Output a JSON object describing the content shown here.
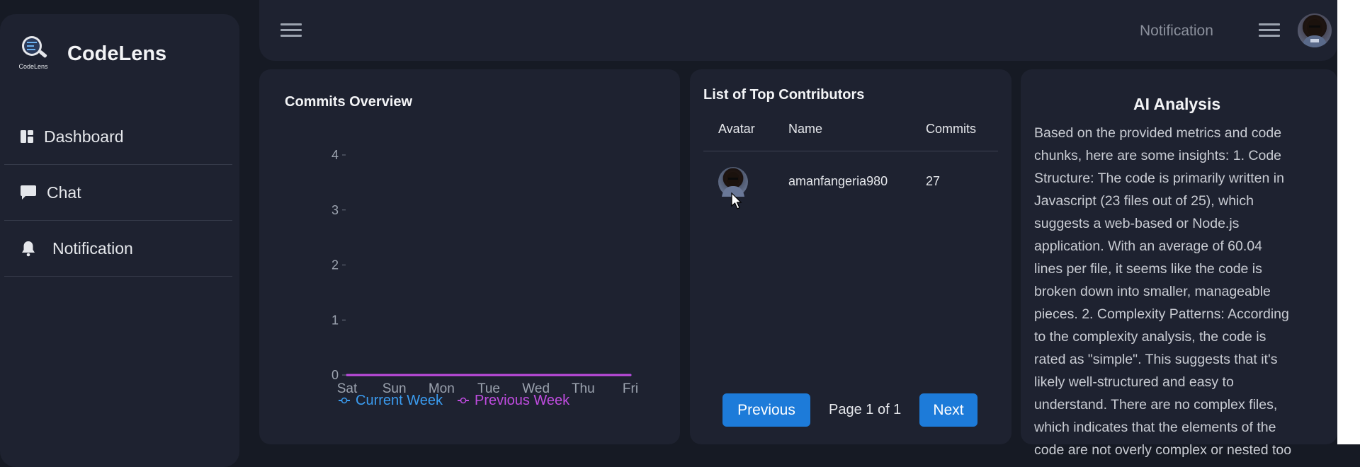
{
  "brand": {
    "name": "CodeLens",
    "logo_text": "CodeLens"
  },
  "sidebar": {
    "items": [
      {
        "label": "Dashboard",
        "icon": "dashboard-icon"
      },
      {
        "label": "Chat",
        "icon": "chat-icon"
      },
      {
        "label": "Notification",
        "icon": "bell-icon"
      }
    ]
  },
  "topbar": {
    "notification_label": "Notification"
  },
  "commits": {
    "title": "Commits Overview",
    "chart_data": {
      "type": "line",
      "categories": [
        "Sat",
        "Sun",
        "Mon",
        "Tue",
        "Wed",
        "Thu",
        "Fri"
      ],
      "series": [
        {
          "name": "Current Week",
          "values": [
            0,
            0,
            0,
            0,
            0,
            0,
            0
          ],
          "color": "#3b9cf0"
        },
        {
          "name": "Previous Week",
          "values": [
            0,
            0,
            0,
            0,
            0,
            0,
            0
          ],
          "color": "#c04ce0"
        }
      ],
      "ylim": [
        0,
        4
      ],
      "yticks": [
        "4",
        "3",
        "2",
        "1",
        "0"
      ],
      "grid": false,
      "legend": "bottom"
    }
  },
  "contributors": {
    "title": "List of Top Contributors",
    "columns": [
      "Avatar",
      "Name",
      "Commits"
    ],
    "rows": [
      {
        "name": "amanfangeria980",
        "commits": "27"
      }
    ],
    "pagination": {
      "previous": "Previous",
      "page_info": "Page 1 of 1",
      "next": "Next"
    }
  },
  "ai_analysis": {
    "title": "AI Analysis",
    "lines": [
      "Based on the provided metrics and code",
      "chunks, here are some insights: 1. Code",
      "Structure: The code is primarily written in",
      "Javascript (23 files out of 25), which",
      "suggests a web-based or Node.js",
      "application. With an average of 60.04",
      "lines per file, it seems like the code is",
      "broken down into smaller, manageable",
      "pieces. 2. Complexity Patterns: According",
      "to the complexity analysis, the code is",
      "rated as \"simple\". This suggests that it's",
      "likely well-structured and easy to",
      "understand. There are no complex files,",
      "which indicates that the elements of the",
      "code are not overly complex or nested too"
    ]
  }
}
